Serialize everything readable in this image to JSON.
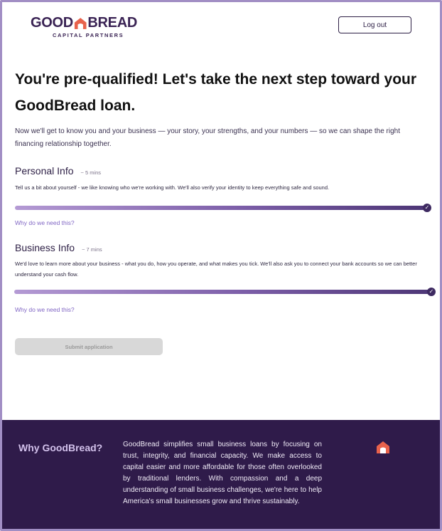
{
  "header": {
    "logo_word_left": "GOOD",
    "logo_word_right": "BREAD",
    "logo_sub": "CAPITAL PARTNERS",
    "logout_label": "Log out"
  },
  "main": {
    "headline_line1": "You're pre-qualified! Let's take the next step toward your",
    "headline_line2": "GoodBread loan.",
    "intro": "Now we'll get to know you and your business — your story, your strengths, and your numbers — so we can shape the right financing relationship together.",
    "sections": [
      {
        "title": "Personal Info",
        "time": "~ 5 mins",
        "description": "Tell us a bit about yourself - we like knowing who we're working with. We'll also verify your identity to keep everything safe and sound.",
        "progress": 1.0,
        "why_link": "Why do we need this?"
      },
      {
        "title": "Business Info",
        "time": "~ 7 mins",
        "description": "We'd love to learn more about your business - what you do, how you operate, and what makes you tick. We'll also ask you to connect your bank accounts so we can better understand your cash flow.",
        "progress": 1.0,
        "why_link": "Why do we need this?"
      }
    ],
    "submit_label": "Submit application"
  },
  "footer": {
    "heading": "Why GoodBread?",
    "body": "GoodBread simplifies small business loans by focusing on trust, integrity, and financial capacity. We make access to capital easier and more affordable for those often overlooked by traditional lenders. With compassion and a deep understanding of small business challenges, we're here to help America's small businesses grow and thrive sustainably."
  },
  "colors": {
    "brand_purple": "#3a2354",
    "accent_orange": "#e8624c",
    "link": "#8066c4",
    "footer_bg": "#2f1b4a"
  },
  "icons": {
    "logo_mark": "house-icon",
    "complete": "check-icon"
  }
}
